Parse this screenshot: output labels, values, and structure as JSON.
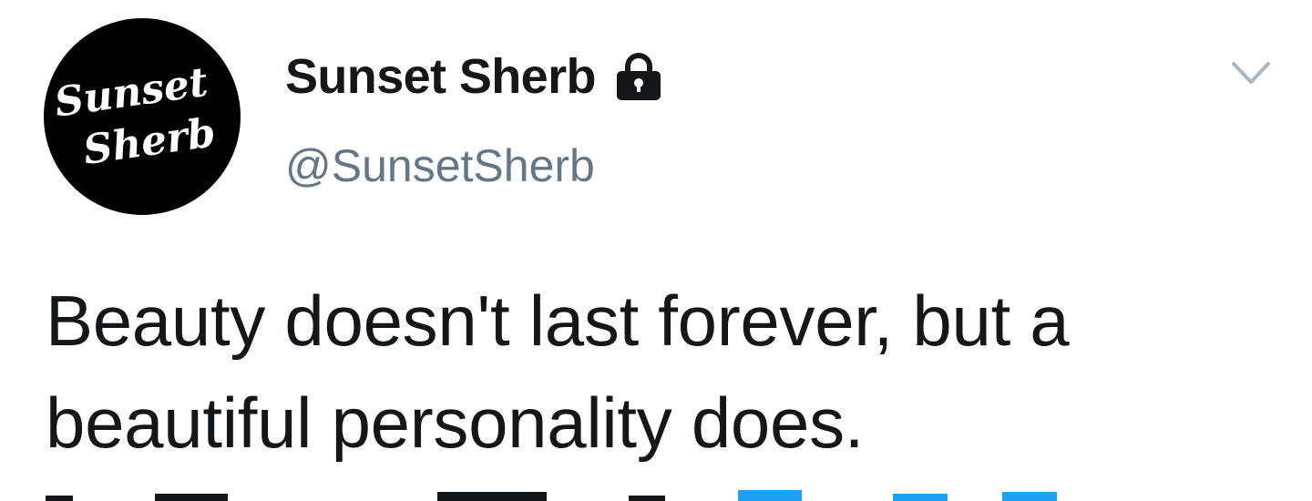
{
  "tweet": {
    "avatar": {
      "logo_line1": "Sunset",
      "logo_line2": "Sherb"
    },
    "display_name": "Sunset Sherb",
    "protected_icon": "lock-icon",
    "handle": "@SunsetSherb",
    "menu_icon": "chevron-down-icon",
    "text": "Beauty doesn't last forever, but a beautiful personality does."
  },
  "colors": {
    "text_primary": "#14171a",
    "text_secondary": "#657786",
    "caret": "#aab8c2",
    "avatar_bg": "#000000",
    "link_accent": "#1da1f2"
  }
}
